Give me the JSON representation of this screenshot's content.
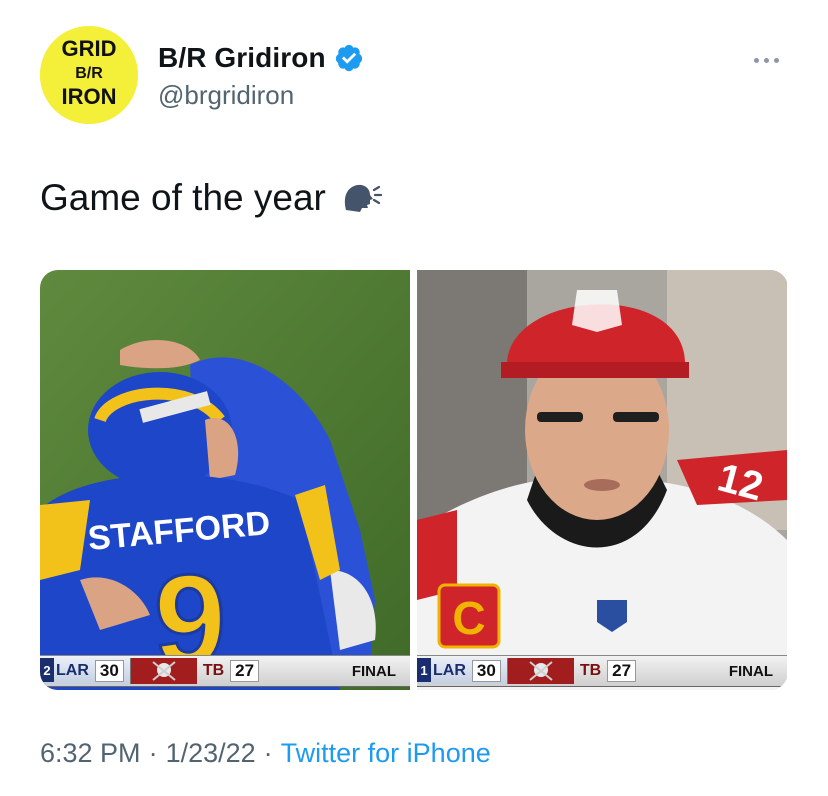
{
  "author": {
    "display_name": "B/R Gridiron",
    "handle": "@brgridiron",
    "verified": true,
    "avatar_text": [
      "GRID",
      "B/R",
      "IRON"
    ]
  },
  "tweet": {
    "text": "Game of the year",
    "emoji": "speaking-head-emoji"
  },
  "media": [
    {
      "jersey_name": "STAFFORD",
      "jersey_number": "9",
      "scoreboard": {
        "lead_marker": "2",
        "team1": "LAR",
        "score1": "30",
        "team2": "TB",
        "score2": "27",
        "status": "FINAL"
      }
    },
    {
      "jersey_number": "12",
      "patch_letter": "C",
      "scoreboard": {
        "lead_marker": "1",
        "team1": "LAR",
        "score1": "30",
        "team2": "TB",
        "score2": "27",
        "status": "FINAL"
      }
    }
  ],
  "meta": {
    "time": "6:32 PM",
    "separator1": "·",
    "date": "1/23/22",
    "separator2": "·",
    "source": "Twitter for iPhone"
  },
  "colors": {
    "avatar_bg": "#f4f03a",
    "verified": "#1d9bf0",
    "link": "#1d9bf0",
    "muted": "#536471",
    "rams_blue": "#1d46c9",
    "rams_yellow": "#f2c21b",
    "bucs_red": "#d0242b"
  }
}
